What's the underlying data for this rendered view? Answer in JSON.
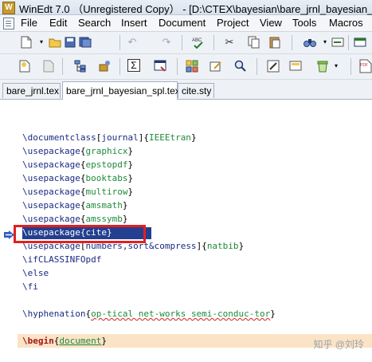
{
  "window": {
    "title": "WinEdt 7.0 （Unregistered  Copy） - [D:\\CTEX\\bayesian\\bare_jrnl_bayesian_"
  },
  "menu": {
    "items": [
      "File",
      "Edit",
      "Search",
      "Insert",
      "Document",
      "Project",
      "View",
      "Tools",
      "Macros"
    ]
  },
  "toolbar1": {
    "icons": [
      "new-file-icon",
      "open-folder-icon",
      "save-icon",
      "save-all-icon",
      "undo-icon",
      "redo-icon",
      "spell-check-icon",
      "cut-icon",
      "copy-icon",
      "paste-icon",
      "find-icon",
      "find-next-icon",
      "window-icon"
    ]
  },
  "toolbar2": {
    "icons": [
      "new-doc-icon",
      "close-doc-icon",
      "tree-icon",
      "project-icon",
      "sum-icon",
      "compile-icon",
      "macros-icon",
      "edit-icon",
      "search-icon",
      "toggle-icon",
      "gather-icon",
      "trash-icon",
      "pdf-icon"
    ]
  },
  "tabs": [
    {
      "label": "bare_jrnl.tex",
      "active": false
    },
    {
      "label": "bare_jrnl_bayesian_spl.tex",
      "active": true
    },
    {
      "label": "cite.sty",
      "active": false
    }
  ],
  "editor": {
    "lines": [
      {
        "cmd": "\\documentclass",
        "opt": "journal",
        "arg": "IEEEtran"
      },
      {
        "cmd": "\\usepackage",
        "arg": "graphicx"
      },
      {
        "cmd": "\\usepackage",
        "arg": "epstopdf"
      },
      {
        "cmd": "\\usepackage",
        "arg": "booktabs"
      },
      {
        "cmd": "\\usepackage",
        "arg": "multirow"
      },
      {
        "cmd": "\\usepackage",
        "arg": "amsmath"
      },
      {
        "cmd": "\\usepackage",
        "arg": "amssymb"
      },
      {
        "cmd": "\\usepackage",
        "arg": "cite"
      },
      {
        "cmd": "\\usepackage",
        "opt": "numbers,sort&compress",
        "arg": "natbib"
      },
      {
        "cmd": "\\ifCLASSINFOpdf"
      },
      {
        "cmd": "\\else"
      },
      {
        "cmd": "\\fi"
      },
      {
        "cmd": "\\hyphenation",
        "arg": "op-tical net-works semi-conduc-tor"
      },
      {
        "cmd": "\\begin",
        "arg": "document"
      }
    ]
  },
  "watermark": "知乎 @刘玲"
}
